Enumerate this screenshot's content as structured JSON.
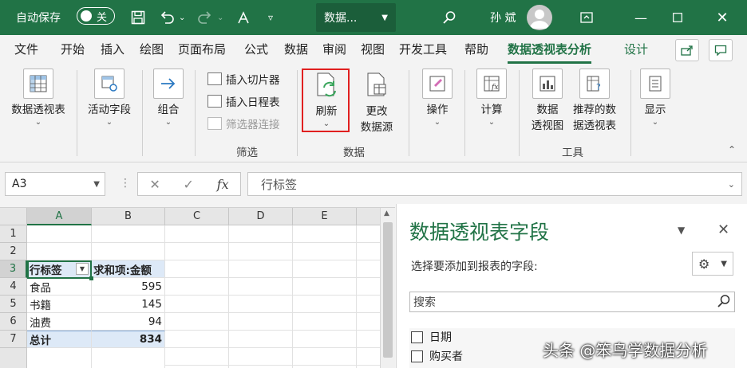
{
  "titlebar": {
    "autosave_label": "自动保存",
    "autosave_state": "关",
    "filename": "数据...",
    "user_name": "孙 斌",
    "bg_color": "#217346"
  },
  "menu": {
    "tabs": [
      "文件",
      "开始",
      "插入",
      "绘图",
      "页面布局",
      "公式",
      "数据",
      "审阅",
      "视图",
      "开发工具",
      "帮助",
      "数据透视表分析",
      "设计"
    ],
    "active_tab": "数据透视表分析"
  },
  "ribbon": {
    "pivot_table": "数据透视表",
    "active_field": "活动字段",
    "group": "组合",
    "insert_slicer": "插入切片器",
    "insert_timeline": "插入日程表",
    "filter_connections": "筛选器连接",
    "filter_group": "筛选",
    "refresh": "刷新",
    "change_source_1": "更改",
    "change_source_2": "数据源",
    "data_group": "数据",
    "actions": "操作",
    "calculations": "计算",
    "pivot_chart_1": "数据",
    "pivot_chart_2": "透视图",
    "recommended_1": "推荐的数",
    "recommended_2": "据透视表",
    "tools_group": "工具",
    "show": "显示"
  },
  "formula_bar": {
    "name_box": "A3",
    "fx": "fx",
    "content": "行标签"
  },
  "sheet": {
    "columns": [
      "A",
      "B",
      "C",
      "D",
      "E"
    ],
    "rows": [
      "1",
      "2",
      "3",
      "4",
      "5",
      "6",
      "7"
    ],
    "pivot_header": [
      "行标签",
      "求和项:金额"
    ],
    "pivot_rows": [
      {
        "label": "食品",
        "value": "595"
      },
      {
        "label": "书籍",
        "value": "145"
      },
      {
        "label": "油费",
        "value": "94"
      }
    ],
    "total": {
      "label": "总计",
      "value": "834"
    }
  },
  "pane": {
    "title": "数据透视表字段",
    "subtitle": "选择要添加到报表的字段:",
    "search_placeholder": "搜索",
    "fields": [
      "日期",
      "购买者"
    ]
  },
  "watermark": "头条 @笨鸟学数据分析"
}
